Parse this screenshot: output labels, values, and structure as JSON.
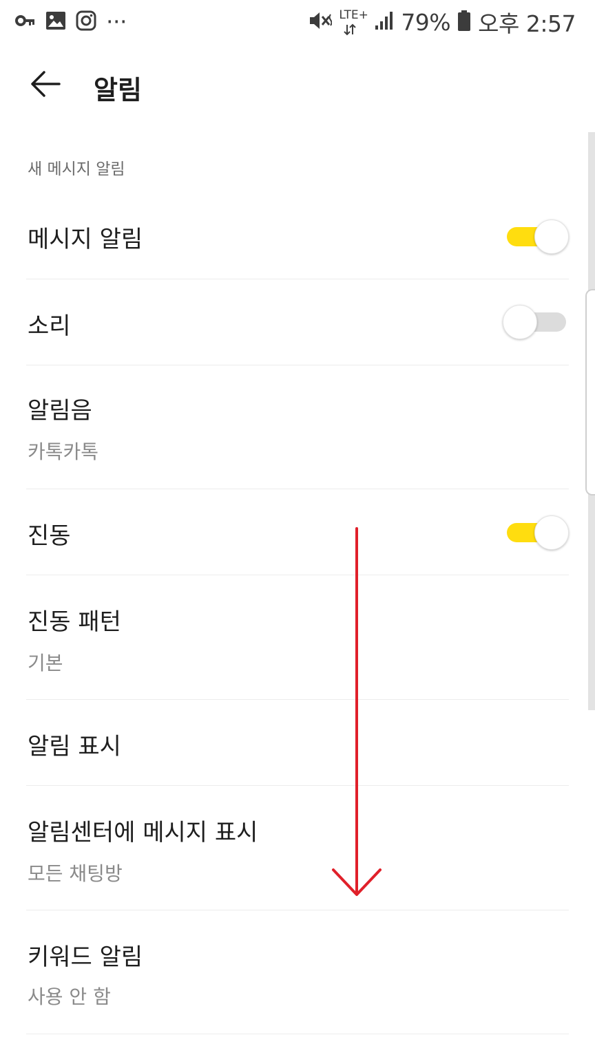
{
  "status_bar": {
    "left_icons": [
      "key-icon",
      "image-icon",
      "instagram-icon",
      "more-icon"
    ],
    "more_text": "···",
    "network": "LTE+",
    "battery": "79%",
    "time": "오후 2:57"
  },
  "header": {
    "title": "알림"
  },
  "section": {
    "label": "새 메시지 알림"
  },
  "settings": {
    "message_alert": {
      "title": "메시지 알림",
      "toggle": true
    },
    "sound": {
      "title": "소리",
      "toggle": false
    },
    "ringtone": {
      "title": "알림음",
      "value": "카톡카톡"
    },
    "vibration": {
      "title": "진동",
      "toggle": true
    },
    "vibration_pattern": {
      "title": "진동 패턴",
      "value": "기본"
    },
    "alert_display": {
      "title": "알림 표시"
    },
    "notification_center": {
      "title": "알림센터에 메시지 표시",
      "value": "모든 채팅방"
    },
    "keyword_alert": {
      "title": "키워드 알림",
      "value": "사용 안 함"
    }
  },
  "colors": {
    "toggle_on": "#ffdd0f",
    "toggle_off": "#dcdcdc",
    "annotation_arrow": "#e0202a"
  }
}
